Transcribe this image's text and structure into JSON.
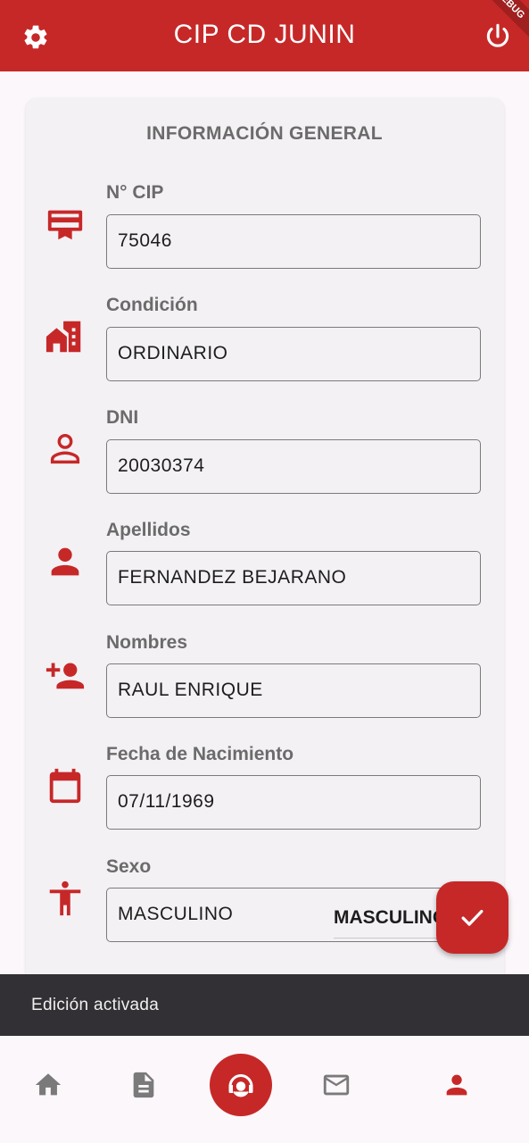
{
  "appbar": {
    "title": "CIP CD JUNIN",
    "left_icon": "gear-icon",
    "right_icon": "power-icon",
    "debug_badge": "DEBUG",
    "color": "#c62828"
  },
  "card": {
    "title": "INFORMACIÓN GENERAL",
    "fields": [
      {
        "label": "N° CIP",
        "value": "75046",
        "icon": "id-card-icon"
      },
      {
        "label": "Condición",
        "value": "ORDINARIO",
        "icon": "house-building-icon"
      },
      {
        "label": "DNI",
        "value": "20030374",
        "icon": "person-outline-icon"
      },
      {
        "label": "Apellidos",
        "value": "FERNANDEZ BEJARANO",
        "icon": "person-icon"
      },
      {
        "label": "Nombres",
        "value": "RAUL ENRIQUE",
        "icon": "add-person-icon"
      },
      {
        "label": "Fecha de Nacimiento",
        "value": "07/11/1969",
        "icon": "calendar-icon"
      },
      {
        "label": "Sexo",
        "value": "MASCULINO",
        "icon": "accessibility-icon",
        "select_value": "MASCULINO"
      }
    ]
  },
  "fab": {
    "icon": "check-icon"
  },
  "snackbar": {
    "message": "Edición activada"
  },
  "bottom_nav": {
    "items": [
      "home-icon",
      "document-icon",
      "support-agent-icon",
      "mail-icon",
      "person-icon"
    ],
    "active": "person-icon"
  },
  "colors": {
    "accent": "#c62828",
    "label": "#6b6b6b",
    "inactive_nav": "#7a7a7a"
  }
}
